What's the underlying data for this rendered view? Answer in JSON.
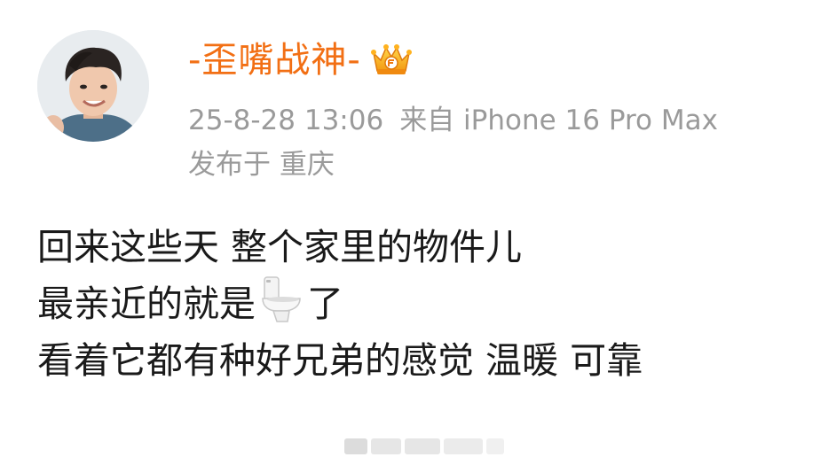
{
  "post": {
    "author": {
      "name": "-歪嘴战神-",
      "badge_icon": "vip-crown-icon",
      "name_color": "#f26f14"
    },
    "meta": {
      "datetime": "25-8-28 13:06",
      "source": "来自 iPhone 16 Pro Max",
      "location": "发布于 重庆"
    },
    "content": {
      "line1": "回来这些天 整个家里的物件儿",
      "line2_before": "最亲近的就是",
      "line2_emoji": "toilet-emoji",
      "line2_after": "了",
      "line3": "看着它都有种好兄弟的感觉 温暖 可靠"
    }
  }
}
